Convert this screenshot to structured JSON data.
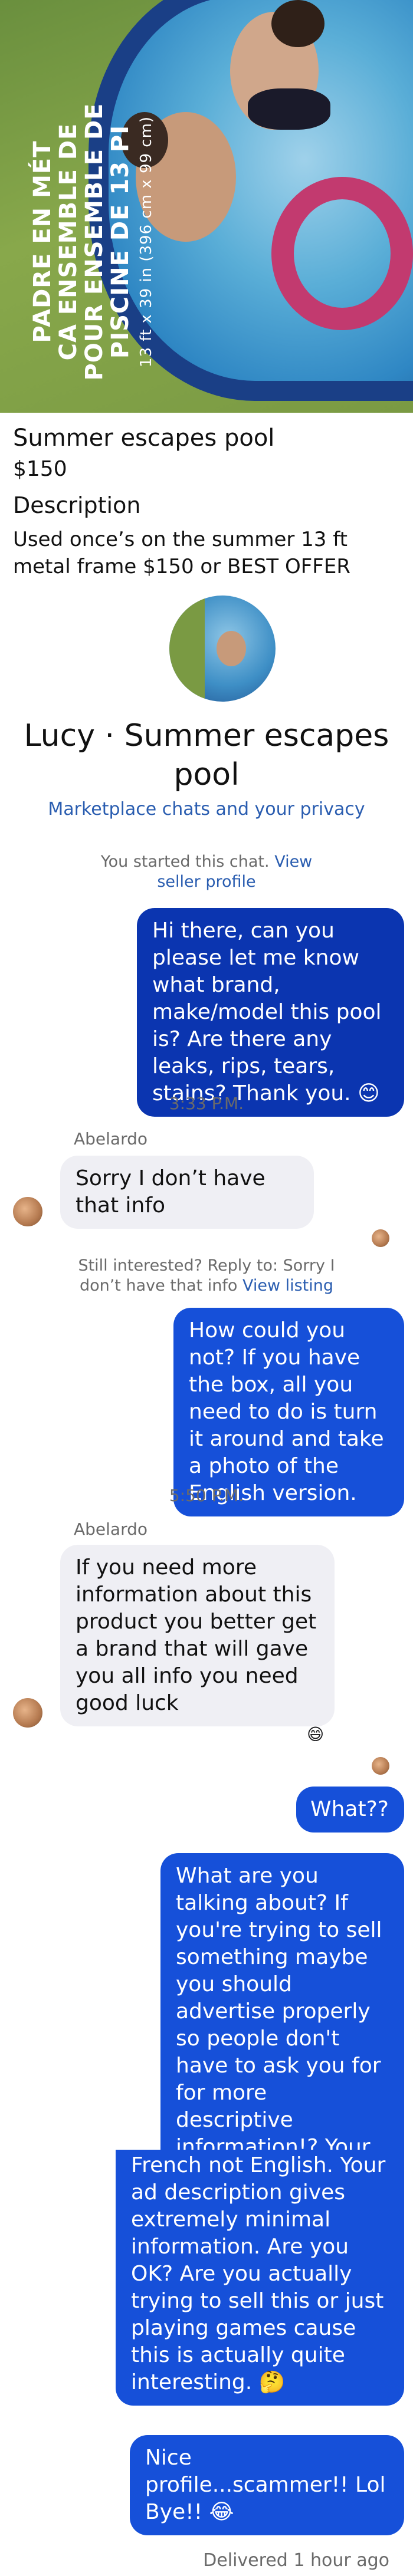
{
  "hero": {
    "rim_text_line1": "PADRE EN MÉT",
    "rim_text_line2": "CA ENSEMBLE DE",
    "rim_text_line3": "POUR ENSEMBLE DE",
    "rim_text_line4": "PISCINE DE 13 PI",
    "rim_text_line5": "13 ft x 39 in (396 cm x 99 cm)"
  },
  "listing": {
    "title": "Summer escapes pool",
    "price": "$150",
    "description_heading": "Description",
    "description": "Used once’s on the summer  13 ft metal frame $150 or BEST OFFER"
  },
  "chat_header": {
    "name": "Lucy · Summer escapes pool",
    "privacy_link": "Marketplace chats and your privacy"
  },
  "system": {
    "started_text": "You started this chat.",
    "view_seller_profile": "View seller profile",
    "still_interested": "Still interested? Reply to: Sorry I don’t have that info",
    "view_listing": "View listing"
  },
  "messages": {
    "m1": "Hi there, can you please let me know what brand, make/model this pool is? Are there any leaks, rips, tears, stains? Thank you. 😊",
    "ts1": "3:33 P.M.",
    "sender1": "Abelardo",
    "m2": "Sorry I don’t have that info",
    "m3": "How could you not? If you have the box, all you need to do is turn it around and take a photo of the English version.",
    "ts2": "5:50 P.M.",
    "sender2": "Abelardo",
    "m4": "If you need more information about this product you better get a brand that will gave you all info you need good luck",
    "reaction": "😄",
    "m5": "What??",
    "m6a": "What are you talking about? If you're trying to sell something maybe you should advertise properly so people don't have to ask you for for more descriptive information!? Your photo is of the box...in",
    "m6b": "French not English. Your ad description gives extremely minimal information. Are you OK? Are you actually trying to sell this or just playing games cause this is actually quite interesting. 🤔",
    "m7": "Nice profile...scammer!! Lol Bye!! 😂",
    "delivered": "Delivered 1 hour ago"
  },
  "colors": {
    "outgoing_bubble": "#1650d9",
    "incoming_bubble": "#efeff4",
    "link": "#2a5db0"
  }
}
